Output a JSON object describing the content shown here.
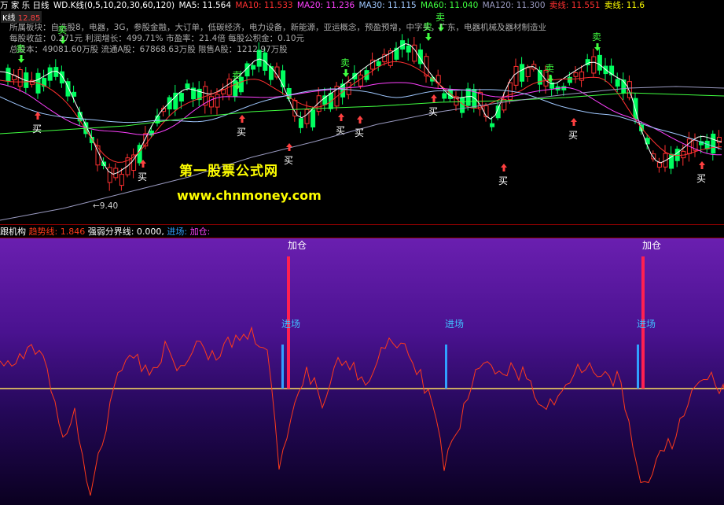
{
  "header": {
    "title": "万 家 乐 日线",
    "indicator": "WD.K线(0,5,10,20,30,60,120)",
    "ma5": "MA5: 11.564",
    "ma10": "MA10: 11.533",
    "ma20": "MA20: 11.236",
    "ma30": "MA30: 11.115",
    "ma60": "MA60: 11.040",
    "ma120": "MA120: 11.300",
    "sell_line": "卖线: 11.551",
    "sell_line2": "卖线: 11.6",
    "kline_tag": "K线",
    "price_tag": "12.85"
  },
  "info": {
    "line1": "所属板块：自选股8，电器，3G，参股金融，大订单，低碳经济，电力设备，新能源，亚运概念，预盈预增，中字头，广东，电器机械及器材制造业",
    "line2": "每股收益：0.271元    利润增长：499.71%    市盈率：21.4倍    每股公积金：0.10元",
    "line3": "总股本：49081.60万股    流通A股：67868.63万股    限售A股：1212.97万股"
  },
  "watermark": {
    "site_name": "第一股票公式网",
    "site_url": "www.chnmoney.com"
  },
  "annotation": {
    "low_price": "←9.40"
  },
  "signals": {
    "buy": "买",
    "sell": "卖"
  },
  "sub_panel": {
    "name": "跟机构",
    "trend": "趋势线: 1.846",
    "divider": "强弱分界线: 0.000,",
    "enter": "进场:",
    "add": "加仓:",
    "label_enter": "进场",
    "label_add": "加仓"
  },
  "colors": {
    "candle_up": "#ff3030",
    "candle_down": "#00ff60",
    "ma5": "#ffffff",
    "ma10": "#ff3030",
    "ma20": "#ff40ff",
    "ma30": "#a0c8ff",
    "ma60": "#40ff40",
    "ma120": "#9a9ac0",
    "trend": "#ff3a1a",
    "divider": "#ffe060",
    "enter": "#30a0ff",
    "add": "#ff2050"
  }
}
